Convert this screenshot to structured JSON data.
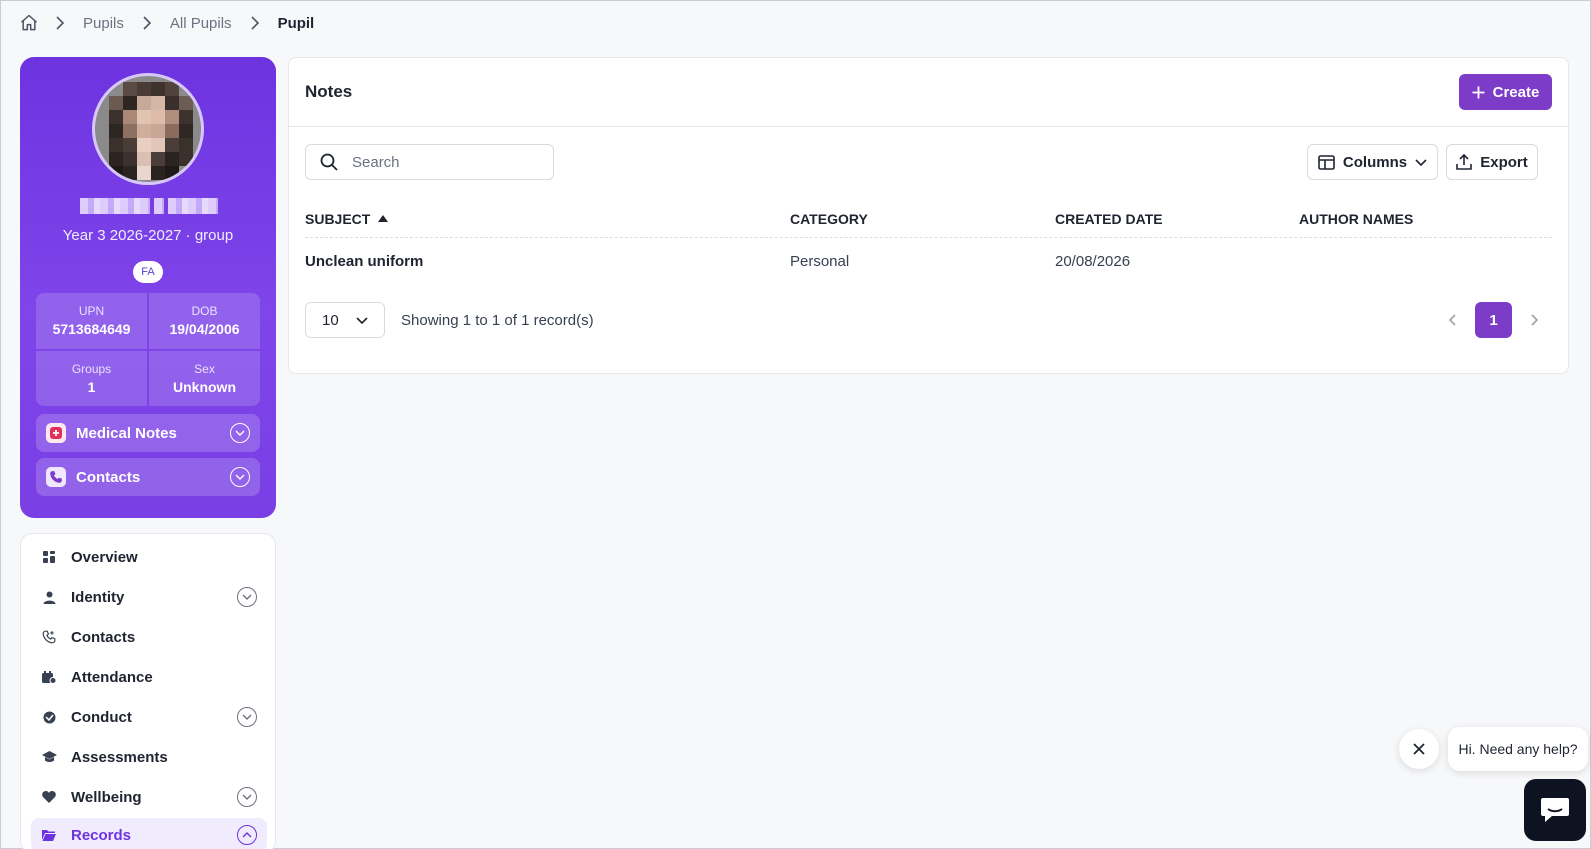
{
  "breadcrumb": {
    "home_icon": "home-icon",
    "items": [
      "Pupils",
      "All Pupils",
      "Pupil"
    ]
  },
  "profile": {
    "group_line": "Year 3 2026-2027 · group",
    "badge": "FA",
    "stats": [
      {
        "label": "UPN",
        "value": "5713684649"
      },
      {
        "label": "DOB",
        "value": "19/04/2006"
      },
      {
        "label": "Groups",
        "value": "1"
      },
      {
        "label": "Sex",
        "value": "Unknown"
      }
    ],
    "accordions": [
      {
        "label": "Medical Notes",
        "icon": "medical-icon"
      },
      {
        "label": "Contacts",
        "icon": "phone-icon"
      }
    ],
    "colors": {
      "accent": "#6d33e0"
    }
  },
  "sidenav": {
    "items": [
      {
        "label": "Overview",
        "icon": "grid-icon"
      },
      {
        "label": "Identity",
        "icon": "person-icon"
      },
      {
        "label": "Contacts",
        "icon": "phone-icon"
      },
      {
        "label": "Attendance",
        "icon": "calendar-icon"
      },
      {
        "label": "Conduct",
        "icon": "balance-icon"
      },
      {
        "label": "Assessments",
        "icon": "graduation-icon"
      },
      {
        "label": "Wellbeing",
        "icon": "heart-icon"
      },
      {
        "label": "Records",
        "icon": "folder-icon"
      }
    ]
  },
  "notes": {
    "title": "Notes",
    "create_label": "Create",
    "search_placeholder": "Search",
    "columns_label": "Columns",
    "export_label": "Export",
    "columns": [
      "SUBJECT",
      "CATEGORY",
      "CREATED DATE",
      "AUTHOR NAMES"
    ],
    "rows": [
      {
        "subject": "Unclean uniform",
        "category": "Personal",
        "created_date": "20/08/2026",
        "author_names": ""
      }
    ],
    "page_size": "10",
    "showing": "Showing 1 to 1 of 1 record(s)",
    "current_page": "1",
    "colors": {
      "button": "#7d3cc8"
    }
  },
  "help": {
    "bubble": "Hi. Need any help?"
  }
}
